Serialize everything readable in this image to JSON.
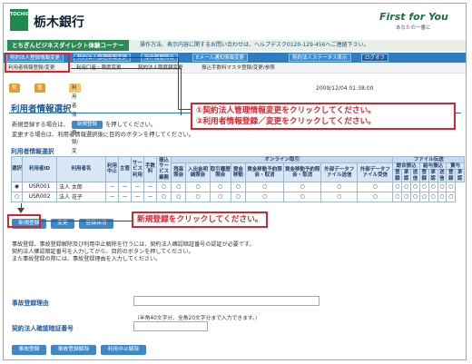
{
  "header": {
    "logo_text": "TOCHIGIN",
    "bank_name": "栃木銀行",
    "brand": "First for You",
    "brand_sub": "あなたの一番に"
  },
  "topbar": {
    "service_name": "とちぎんビジネスダイレクト体験コーナー",
    "help_text": "操作方法、表示内容に関するお問い合わせは、ヘルプデスク0120-129-456へご連絡下さい。"
  },
  "nav": {
    "items": [
      "契約法人登録情報変更",
      "契約法人管理情報変更",
      "操作履歴照会",
      "Eメール通知情報変更",
      "契約法人ステータス表示",
      "ログオフ"
    ]
  },
  "subnav": {
    "items": [
      "利用者情報登録/変更",
      "利用口座・限度変更",
      "契約法人限度額変更",
      "振込手数料マスタ登録/変更/参照"
    ]
  },
  "tabs": {
    "items": [
      "契約法人",
      "管理者情報",
      "利用者情報登録/変更"
    ]
  },
  "datetime": "2009/12/04 01:38:00",
  "page_title": "利用者情報選択",
  "intro": {
    "line1_pre": "新規登録する場合は、",
    "new_btn": "新規登録",
    "line1_post": "を押してください。",
    "line2": "変更する場合は、利用者情報選択後に目的のボタンを押してください。"
  },
  "section_title": "利用者情報選択",
  "table": {
    "headers": {
      "select": "選択",
      "user_id": "利用者ID",
      "user_name": "利用者名",
      "stop": "利用中止",
      "master": "主管",
      "service": "サービス利用",
      "fee": "手数料",
      "admin_svc": "振込サービス業務",
      "online": "オンライン取引",
      "file": "ファイル伝送"
    },
    "online_cols": [
      "残高照会",
      "入出金明細照会",
      "取引履歴照会",
      "資金移動",
      "資金移動予約照会・取消",
      "資金移動予約照会・取消",
      "外部データファイル送信",
      "外部データファイル受信"
    ],
    "file_groups": [
      "総合振込",
      "給与振込",
      "賞与"
    ],
    "file_cols": [
      "登録",
      "承認",
      "送信",
      "登録",
      "承認",
      "送信",
      "登録",
      "承認"
    ],
    "rows": [
      {
        "id": "USR001",
        "name": "法人 太郎",
        "cells": [
          "－",
          "－",
          "－",
          "－",
          "○",
          "○",
          "○",
          "○",
          "○",
          "○",
          "○",
          "○",
          "○",
          "○",
          "○",
          "○",
          "○",
          "○",
          "○",
          "○"
        ]
      },
      {
        "id": "USR002",
        "name": "法人 花子",
        "cells": [
          "－",
          "－",
          "－",
          "－",
          "○",
          "○",
          "○",
          "○",
          "○",
          "○",
          "○",
          "○",
          "○",
          "○",
          "○",
          "○",
          "○",
          "○",
          "○",
          "○"
        ]
      }
    ]
  },
  "buttons": {
    "new": "新規登録",
    "change": "変更",
    "delete": "登録抹消"
  },
  "notice": {
    "line1": "事故登録、事故登録解除及び利用中止解除を行うには、契約法人確認暗証番号の認証が必要です。",
    "line2": "契約法人確認暗証番号を入力してから、目的のボタンを押してください。",
    "line3": "また事故登録の際には、事故登録理由を入力してください。"
  },
  "fields": {
    "reason_label": "事故登録理由",
    "reason_hint": "（半角40文字分、全角20文字分まで入力できます。）",
    "pin_label": "契約法人確認暗証番号"
  },
  "bottom_buttons": [
    "事故登録",
    "事故登録解除",
    "利用中止解除"
  ],
  "callouts": {
    "c1_line1": "①契約法人管理情報変更をクリックしてください。",
    "c1_line2": "②利用者情報登録／変更をクリックしてください。",
    "c2": "新規登録をクリックしてください。"
  },
  "colors": {
    "accent_red": "#d9232d",
    "nav_blue": "#2f7dc1",
    "brand_green": "#1b6f3b"
  }
}
